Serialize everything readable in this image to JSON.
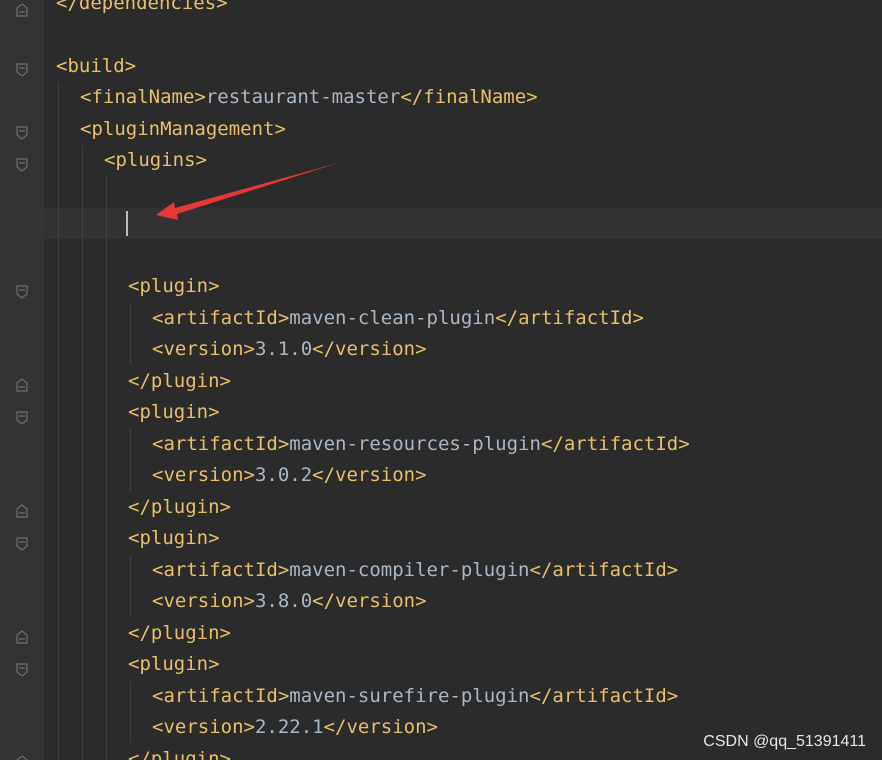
{
  "colors": {
    "background": "#2b2b2b",
    "gutter": "#313335",
    "tag": "#e8bf6a",
    "text": "#a9b7c6",
    "annotation_arrow": "#e53935"
  },
  "code_lines": [
    {
      "open": "</dependencies>",
      "text": "",
      "close": ""
    },
    {
      "open": "",
      "text": "",
      "close": ""
    },
    {
      "open": "<build>",
      "text": "",
      "close": ""
    },
    {
      "open": "<finalName>",
      "text": "restaurant-master",
      "close": "</finalName>"
    },
    {
      "open": "<pluginManagement>",
      "text": "",
      "close": ""
    },
    {
      "open": "<plugins>",
      "text": "",
      "close": ""
    },
    {
      "open": "",
      "text": "",
      "close": ""
    },
    {
      "open": "",
      "text": "",
      "close": ""
    },
    {
      "open": "",
      "text": "",
      "close": ""
    },
    {
      "open": "<plugin>",
      "text": "",
      "close": ""
    },
    {
      "open": "<artifactId>",
      "text": "maven-clean-plugin",
      "close": "</artifactId>"
    },
    {
      "open": "<version>",
      "text": "3.1.0",
      "close": "</version>"
    },
    {
      "open": "</plugin>",
      "text": "",
      "close": ""
    },
    {
      "open": "<plugin>",
      "text": "",
      "close": ""
    },
    {
      "open": "<artifactId>",
      "text": "maven-resources-plugin",
      "close": "</artifactId>"
    },
    {
      "open": "<version>",
      "text": "3.0.2",
      "close": "</version>"
    },
    {
      "open": "</plugin>",
      "text": "",
      "close": ""
    },
    {
      "open": "<plugin>",
      "text": "",
      "close": ""
    },
    {
      "open": "<artifactId>",
      "text": "maven-compiler-plugin",
      "close": "</artifactId>"
    },
    {
      "open": "<version>",
      "text": "3.8.0",
      "close": "</version>"
    },
    {
      "open": "</plugin>",
      "text": "",
      "close": ""
    },
    {
      "open": "<plugin>",
      "text": "",
      "close": ""
    },
    {
      "open": "<artifactId>",
      "text": "maven-surefire-plugin",
      "close": "</artifactId>"
    },
    {
      "open": "<version>",
      "text": "2.22.1",
      "close": "</version>"
    },
    {
      "open": "</plugin>",
      "text": "",
      "close": ""
    }
  ],
  "watermark": "CSDN @qq_51391411"
}
